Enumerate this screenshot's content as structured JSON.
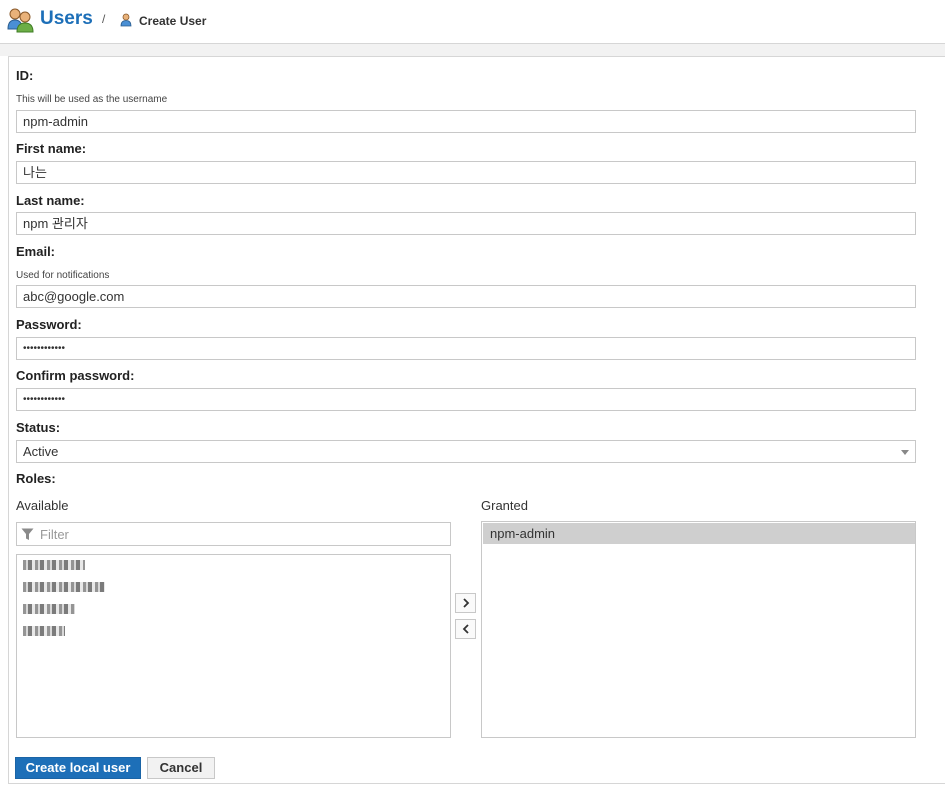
{
  "header": {
    "title": "Users",
    "breadcrumb_separator": "/",
    "current_page": "Create User"
  },
  "form": {
    "id": {
      "label": "ID:",
      "hint": "This will be used as the username",
      "value": "npm-admin"
    },
    "first_name": {
      "label": "First name:",
      "value": "나는"
    },
    "last_name": {
      "label": "Last name:",
      "value": "npm 관리자"
    },
    "email": {
      "label": "Email:",
      "hint": "Used for notifications",
      "value": "abc@google.com"
    },
    "password": {
      "label": "Password:",
      "value": "••••••••••••"
    },
    "confirm_password": {
      "label": "Confirm password:",
      "value": "••••••••••••"
    },
    "status": {
      "label": "Status:",
      "value": "Active"
    },
    "roles": {
      "label": "Roles:",
      "available_label": "Available",
      "granted_label": "Granted",
      "filter_placeholder": "Filter",
      "available_items_redacted": 4,
      "granted_items": [
        "npm-admin"
      ]
    }
  },
  "actions": {
    "create_label": "Create local user",
    "cancel_label": "Cancel"
  },
  "colors": {
    "accent": "#1d6fb8",
    "selected_row": "#cfcfcf"
  }
}
